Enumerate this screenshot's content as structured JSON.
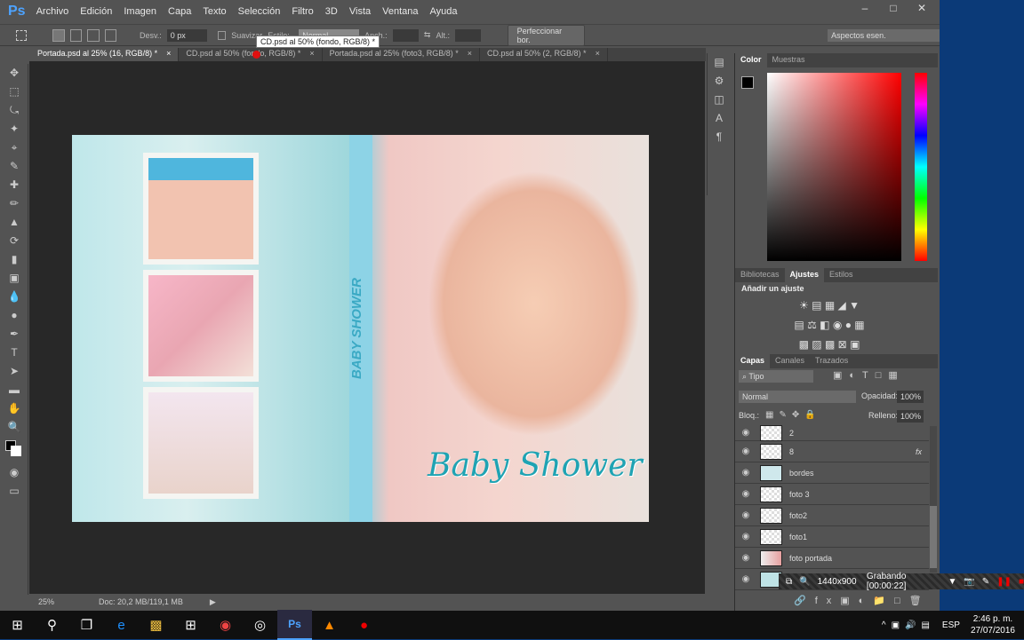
{
  "app": {
    "logo": "Ps",
    "menu": [
      "Archivo",
      "Edición",
      "Imagen",
      "Capa",
      "Texto",
      "Selección",
      "Filtro",
      "3D",
      "Vista",
      "Ventana",
      "Ayuda"
    ]
  },
  "options": {
    "desv_label": "Desv.:",
    "desv_value": "0 px",
    "suavizar": "Suavizar",
    "estilo_label": "Estilo:",
    "estilo_value": "Normal",
    "anch_label": "Anch.:",
    "alt_label": "Alt.:",
    "refine": "Perfeccionar bor.",
    "workspace": "Aspectos esen."
  },
  "tooltip": "CD.psd al 50% (fondo, RGB/8) *",
  "tabs": [
    {
      "label": "Portada.psd al 25% (16, RGB/8) *"
    },
    {
      "label": "CD.psd al 50% (fondo, RGB/8) *"
    },
    {
      "label": "Portada.psd al 25% (foto3, RGB/8) *"
    },
    {
      "label": "CD.psd al 50% (2, RGB/8) *"
    }
  ],
  "canvas": {
    "spine_text": "BABY SHOWER",
    "title_text": "Baby Shower"
  },
  "status": {
    "zoom": "25%",
    "doc": "Doc: 20,2 MB/119,1 MB"
  },
  "color_panel": {
    "tabs": [
      "Color",
      "Muestras"
    ]
  },
  "adjust_panel": {
    "tabs": [
      "Bibliotecas",
      "Ajustes",
      "Estilos"
    ],
    "heading": "Añadir un ajuste"
  },
  "layers_panel": {
    "tabs": [
      "Capas",
      "Canales",
      "Trazados"
    ],
    "filter": "Tipo",
    "blend": "Normal",
    "opacity_label": "Opacidad:",
    "opacity": "100%",
    "lock_label": "Bloq.:",
    "fill_label": "Relleno:",
    "fill": "100%",
    "layers": [
      {
        "name": "2"
      },
      {
        "name": "8",
        "fx": "fx"
      },
      {
        "name": "bordes"
      },
      {
        "name": "foto 3"
      },
      {
        "name": "foto2"
      },
      {
        "name": "foto1"
      },
      {
        "name": "foto portada"
      }
    ]
  },
  "recorder": {
    "size": "1440x900",
    "status": "Grabando [00:00:22]"
  },
  "taskbar": {
    "lang": "ESP",
    "time": "2:46 p. m.",
    "date": "27/07/2016"
  }
}
